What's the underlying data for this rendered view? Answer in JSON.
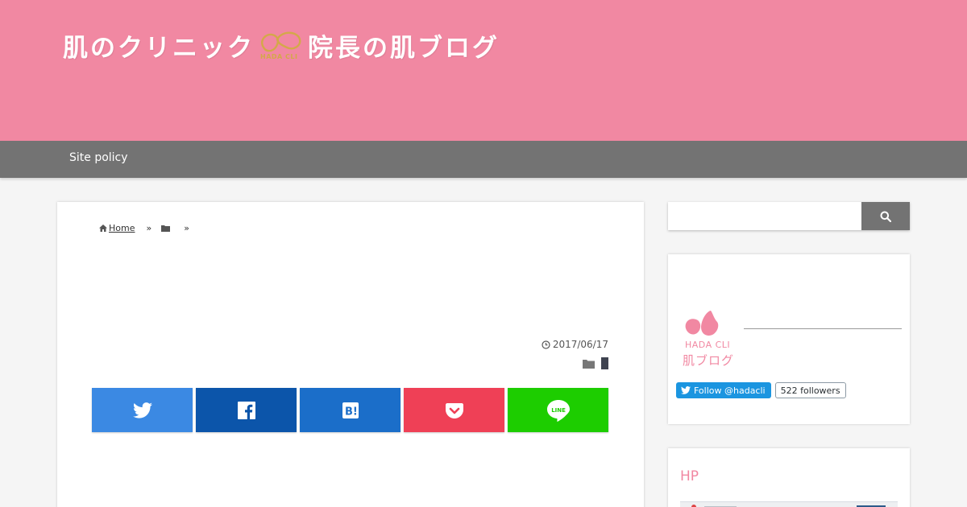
{
  "header": {
    "title_part1": "肌のクリニック",
    "logo_text": "HADA CLI",
    "title_part2": "院長の肌ブログ"
  },
  "nav": {
    "items": [
      {
        "label": "Site policy"
      }
    ]
  },
  "breadcrumb": {
    "home_label": "Home",
    "separator": "»"
  },
  "post": {
    "date": "2017/06/17"
  },
  "share": {
    "buttons": [
      {
        "name": "twitter",
        "color": "#3b89e3",
        "icon": "twitter-bird-icon"
      },
      {
        "name": "facebook",
        "color": "#0c55aa",
        "icon": "facebook-f-icon"
      },
      {
        "name": "hatena",
        "color": "#1b6ec9",
        "icon": "hatena-b-icon"
      },
      {
        "name": "pocket",
        "color": "#ef4056",
        "icon": "pocket-icon"
      },
      {
        "name": "line",
        "color": "#1dcd00",
        "icon": "line-icon"
      }
    ]
  },
  "sidebar": {
    "search": {
      "placeholder": ""
    },
    "profile": {
      "logo_text": "HADA CLI",
      "logo_blog": "肌ブログ",
      "follow_label": "Follow @hadacli",
      "followers": "522 followers"
    },
    "hp_widget": {
      "title": "HP"
    }
  },
  "colors": {
    "header_pink": "#f188a2",
    "nav_gray": "#737373",
    "logo_gold": "#d4a84a"
  }
}
